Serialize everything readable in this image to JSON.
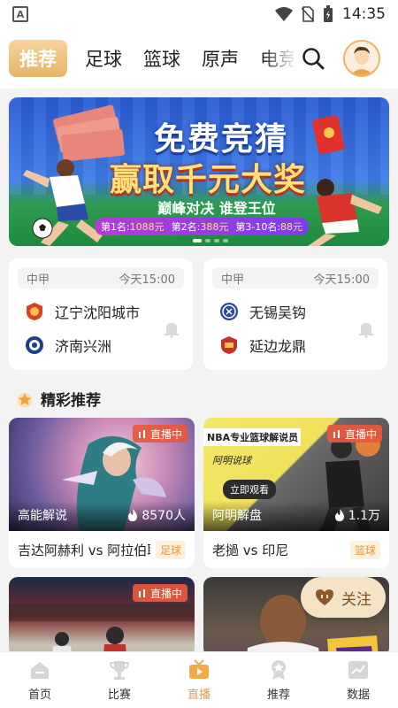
{
  "status_bar": {
    "time": "14:35",
    "app_letter": "A"
  },
  "nav": {
    "tabs": [
      {
        "label": "推荐",
        "active": true
      },
      {
        "label": "足球",
        "active": false
      },
      {
        "label": "篮球",
        "active": false
      },
      {
        "label": "原声",
        "active": false
      },
      {
        "label": "电竞",
        "active": false
      }
    ]
  },
  "banner": {
    "title_line1": "免费竞猜",
    "title_line2": "赢取千元大奖",
    "subtitle": "巅峰对决 谁登王位",
    "prizes": [
      {
        "rank": "第1名:",
        "amount": "1088元"
      },
      {
        "rank": "第2名:",
        "amount": "388元"
      },
      {
        "rank": "第3-10名:",
        "amount": "88元"
      }
    ]
  },
  "matches": [
    {
      "league": "中甲",
      "time": "今天15:00",
      "home": {
        "name": "辽宁沈阳城市",
        "logo_color": "#d9412a"
      },
      "away": {
        "name": "济南兴洲",
        "logo_color": "#1f3f86"
      }
    },
    {
      "league": "中甲",
      "time": "今天15:00",
      "home": {
        "name": "无锡吴钩",
        "logo_color": "#2a4a9a"
      },
      "away": {
        "name": "延边龙鼎",
        "logo_color": "#c8302a"
      }
    }
  ],
  "section": {
    "title": "精彩推荐",
    "icon": "star-icon"
  },
  "live_label": "直播中",
  "videos": [
    {
      "host": "高能解说",
      "viewers": "8570人",
      "title": "吉达阿赫利 vs 阿拉伯联",
      "tag": "足球"
    },
    {
      "host": "阿明解盘",
      "viewers": "1.1万",
      "title": "老撾 vs 印尼",
      "tag": "篮球",
      "thumb_text1": "NBA专业篮球解说员",
      "thumb_text2": "阿明说球",
      "thumb_button": "立即观看"
    },
    {
      "host": "",
      "viewers": "",
      "title": "",
      "tag": ""
    },
    {
      "host": "",
      "viewers": "",
      "title": "",
      "tag": ""
    }
  ],
  "follow_button": {
    "label": "关注"
  },
  "bottom_nav": [
    {
      "label": "首页",
      "icon": "home-icon",
      "active": false
    },
    {
      "label": "比赛",
      "icon": "trophy-icon",
      "active": false
    },
    {
      "label": "直播",
      "icon": "tv-icon",
      "active": true
    },
    {
      "label": "推荐",
      "icon": "badge-icon",
      "active": false
    },
    {
      "label": "数据",
      "icon": "chart-icon",
      "active": false
    }
  ],
  "colors": {
    "accent": "#e89a3c",
    "live_badge": "#e8583c"
  }
}
